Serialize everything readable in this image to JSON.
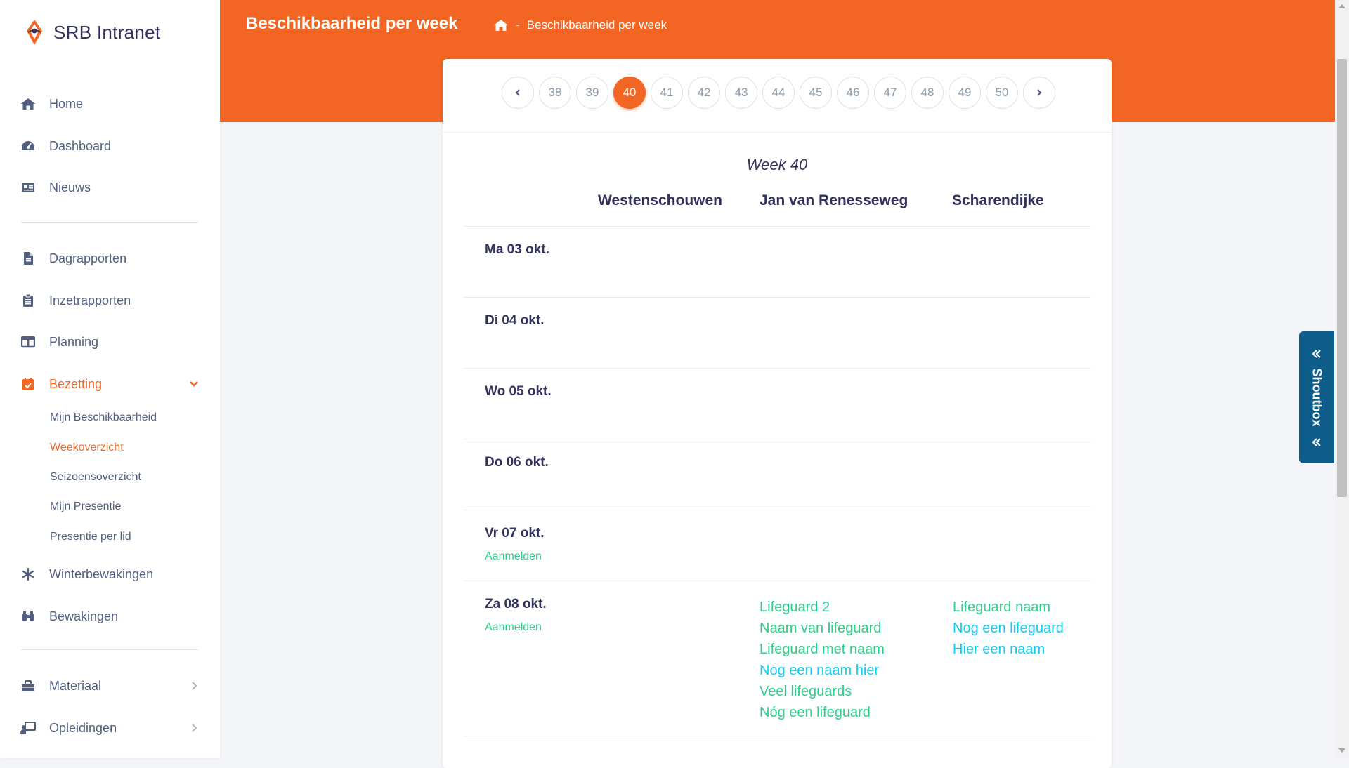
{
  "app": {
    "name": "SRB Intranet"
  },
  "colors": {
    "accent": "#f26522",
    "green": "#2dce89",
    "cyan": "#11cdef",
    "shoutbox": "#0d5c8a"
  },
  "sidebar": {
    "items": [
      {
        "label": "Home",
        "icon": "home-icon"
      },
      {
        "label": "Dashboard",
        "icon": "dashboard-icon"
      },
      {
        "label": "Nieuws",
        "icon": "newspaper-icon"
      },
      {
        "label": "Dagrapporten",
        "icon": "file-icon"
      },
      {
        "label": "Inzetrapporten",
        "icon": "clipboard-icon"
      },
      {
        "label": "Planning",
        "icon": "columns-icon"
      },
      {
        "label": "Bezetting",
        "icon": "calendar-check-icon",
        "expanded": true,
        "active": true
      },
      {
        "label": "Winterbewakingen",
        "icon": "snowflake-icon"
      },
      {
        "label": "Bewakingen",
        "icon": "binoculars-icon"
      },
      {
        "label": "Materiaal",
        "icon": "toolbox-icon"
      },
      {
        "label": "Opleidingen",
        "icon": "chalkboard-teacher-icon"
      }
    ],
    "subitems": [
      {
        "label": "Mijn Beschikbaarheid"
      },
      {
        "label": "Weekoverzicht",
        "active": true
      },
      {
        "label": "Seizoensoverzicht"
      },
      {
        "label": "Mijn Presentie"
      },
      {
        "label": "Presentie per lid"
      }
    ]
  },
  "header": {
    "title": "Beschikbaarheid per week",
    "breadcrumb": {
      "separator": "-",
      "current": "Beschikbaarheid per week"
    }
  },
  "pagination": {
    "weeks": [
      "38",
      "39",
      "40",
      "41",
      "42",
      "43",
      "44",
      "45",
      "46",
      "47",
      "48",
      "49",
      "50"
    ],
    "active": "40"
  },
  "week": {
    "title": "Week 40",
    "columns": [
      "Westenschouwen",
      "Jan van Renesseweg",
      "Scharendijke"
    ],
    "days": [
      {
        "label": "Ma 03 okt.",
        "aanmelden": "",
        "west": [],
        "jan": [],
        "schar": []
      },
      {
        "label": "Di 04 okt.",
        "aanmelden": "",
        "west": [],
        "jan": [],
        "schar": []
      },
      {
        "label": "Wo 05 okt.",
        "aanmelden": "",
        "west": [],
        "jan": [],
        "schar": []
      },
      {
        "label": "Do 06 okt.",
        "aanmelden": "",
        "west": [],
        "jan": [],
        "schar": []
      },
      {
        "label": "Vr 07 okt.",
        "aanmelden": "Aanmelden",
        "west": [],
        "jan": [],
        "schar": []
      },
      {
        "label": "Za 08 okt.",
        "aanmelden": "Aanmelden",
        "west": [],
        "jan": [
          {
            "name": "Lifeguard 2",
            "color": "green"
          },
          {
            "name": "Naam van lifeguard",
            "color": "green"
          },
          {
            "name": "Lifeguard met naam",
            "color": "green"
          },
          {
            "name": "Nog een naam hier",
            "color": "blue"
          },
          {
            "name": "Veel lifeguards",
            "color": "green"
          },
          {
            "name": "Nóg een lifeguard",
            "color": "green"
          }
        ],
        "schar": [
          {
            "name": "Lifeguard naam",
            "color": "green"
          },
          {
            "name": "Nog een lifeguard",
            "color": "blue"
          },
          {
            "name": "Hier een naam",
            "color": "blue"
          }
        ]
      }
    ]
  },
  "shoutbox": {
    "label": "Shoutbox"
  }
}
